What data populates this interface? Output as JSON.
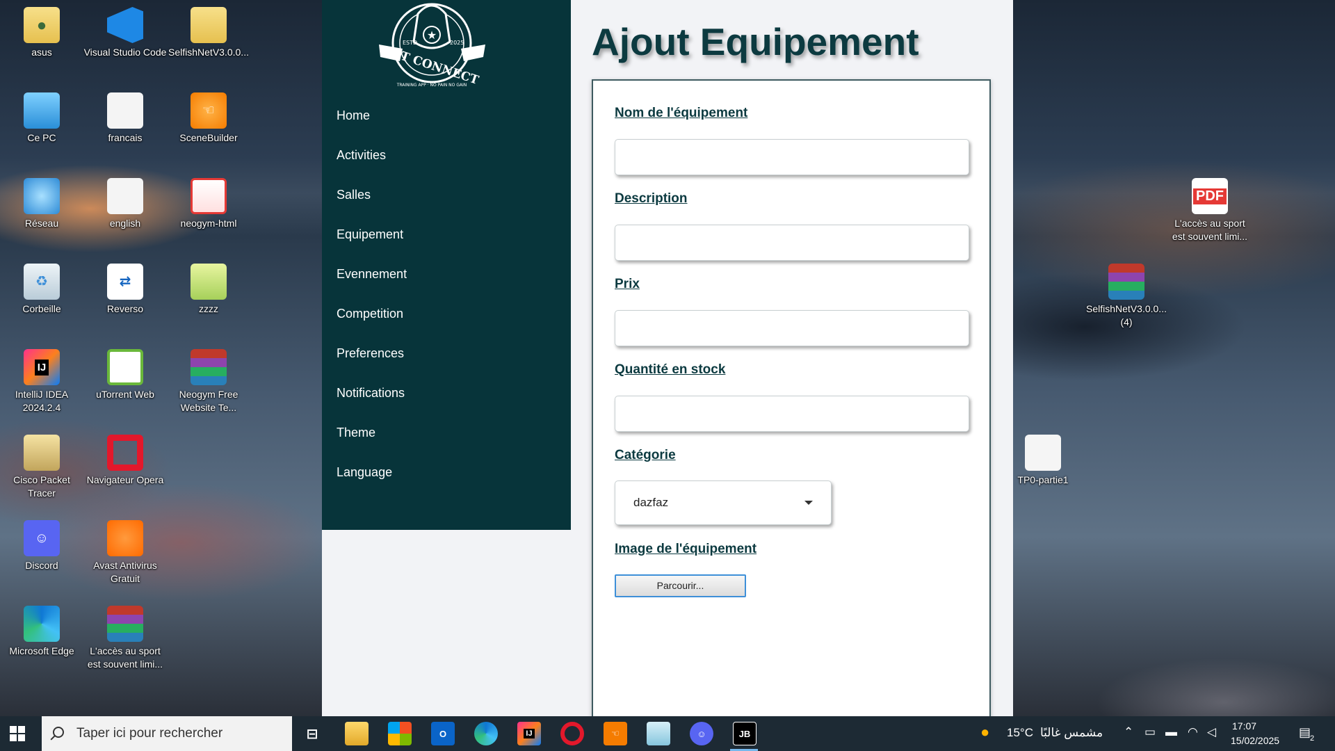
{
  "desktop": {
    "icons_left": [
      {
        "label": "asus",
        "icon": "user-folder-icon"
      },
      {
        "label": "Visual Studio Code",
        "icon": "vscode-icon"
      },
      {
        "label": "SelfishNetV3.0.0...",
        "icon": "folder-icon"
      },
      {
        "label": "Ce PC",
        "icon": "computer-icon"
      },
      {
        "label": "francais",
        "icon": "file-icon"
      },
      {
        "label": "SceneBuilder",
        "icon": "scenebuilder-icon"
      },
      {
        "label": "Réseau",
        "icon": "network-icon"
      },
      {
        "label": "english",
        "icon": "file-icon"
      },
      {
        "label": "neogym-html",
        "icon": "html-folder-icon"
      },
      {
        "label": "Corbeille",
        "icon": "recycle-bin-icon"
      },
      {
        "label": "Reverso",
        "icon": "reverso-icon"
      },
      {
        "label": "zzzz",
        "icon": "folder-icon"
      },
      {
        "label": "IntelliJ IDEA 2024.2.4",
        "icon": "intellij-icon"
      },
      {
        "label": "uTorrent Web",
        "icon": "utorrent-icon"
      },
      {
        "label": "Neogym Free Website Te...",
        "icon": "winrar-icon"
      },
      {
        "label": "Cisco Packet Tracer",
        "icon": "cisco-icon"
      },
      {
        "label": "Navigateur Opera",
        "icon": "opera-icon"
      },
      {
        "label": "Discord",
        "icon": "discord-icon"
      },
      {
        "label": "Avast Antivirus Gratuit",
        "icon": "avast-icon"
      },
      {
        "label": "Microsoft Edge",
        "icon": "edge-icon"
      },
      {
        "label": "L'accès au sport est souvent limi...",
        "icon": "winrar-icon"
      }
    ],
    "icons_right": [
      {
        "label": "L'accès au sport est souvent limi...",
        "icon": "pdf-icon"
      },
      {
        "label": "SelfishNetV3.0.0... (4)",
        "icon": "winrar-icon"
      },
      {
        "label": "TP0-partie1",
        "icon": "text-file-icon"
      }
    ]
  },
  "app": {
    "logo": {
      "brand": "FIT CONNECT",
      "est": "ESTD",
      "year": "2025",
      "tagline": "TRAINING APP · NO PAIN NO GAIN"
    },
    "nav": [
      "Home",
      "Activities",
      "Salles",
      "Equipement",
      "Evennement",
      "Competition",
      "Preferences",
      "Notifications",
      "Theme",
      "Language"
    ],
    "page_title": "Ajout Equipement",
    "form": {
      "name_label": "Nom de l'équipement",
      "name_value": "",
      "description_label": "Description",
      "description_value": "",
      "price_label": "Prix",
      "price_value": "",
      "stock_label": "Quantité en stock",
      "stock_value": "",
      "category_label": "Catégorie",
      "category_selected": "dazfaz",
      "image_label": "Image de l'équipement",
      "browse_label": "Parcourir..."
    },
    "colors": {
      "sidebar": "#07343a",
      "title": "#0c3a40",
      "content_bg": "#f2f3f6"
    }
  },
  "taskbar": {
    "search_placeholder": "Taper ici pour rechercher",
    "pinned": [
      "task-view-icon",
      "file-explorer-icon",
      "microsoft-store-icon",
      "outlook-icon",
      "edge-icon",
      "intellij-icon",
      "opera-icon",
      "scenebuilder-icon",
      "notepad-icon",
      "discord-icon",
      "jetbrains-icon"
    ],
    "weather_temp": "15°C",
    "weather_desc": "مشمس غالبًا",
    "time": "17:07",
    "date": "15/02/2025",
    "notifications_count": "2"
  }
}
